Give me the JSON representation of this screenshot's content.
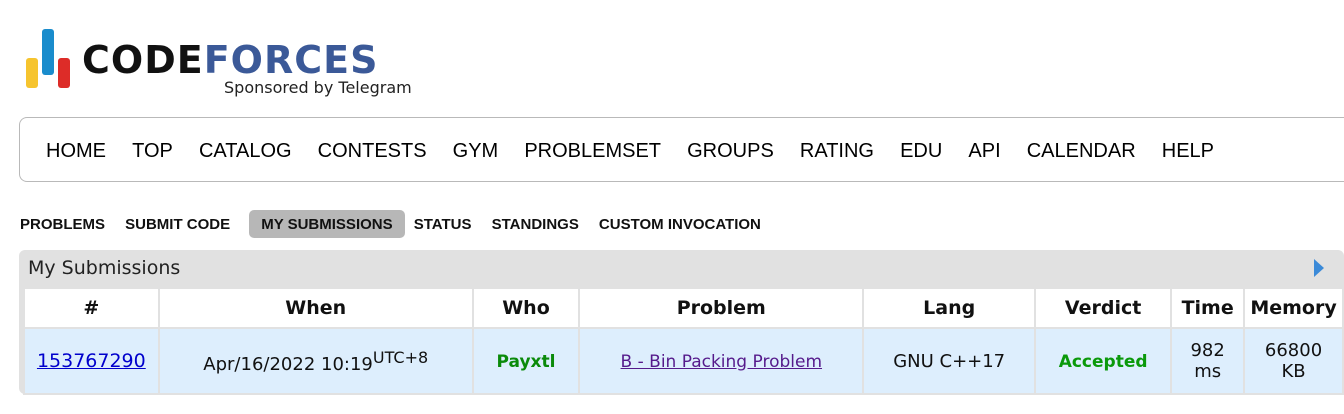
{
  "logo": {
    "word_part1": "CODE",
    "word_part2": "FORCES",
    "sponsor": "Sponsored by Telegram",
    "colors": {
      "yellow": "#f6c42e",
      "blue": "#1a8ccc",
      "red": "#dd2c28",
      "forces": "#3b5998"
    }
  },
  "main_menu": [
    "HOME",
    "TOP",
    "CATALOG",
    "CONTESTS",
    "GYM",
    "PROBLEMSET",
    "GROUPS",
    "RATING",
    "EDU",
    "API",
    "CALENDAR",
    "HELP"
  ],
  "second_menu": {
    "items": [
      "PROBLEMS",
      "SUBMIT CODE",
      "MY SUBMISSIONS",
      "STATUS",
      "STANDINGS",
      "CUSTOM INVOCATION"
    ],
    "active": "MY SUBMISSIONS"
  },
  "submissions": {
    "title": "My Submissions",
    "columns": [
      "#",
      "When",
      "Who",
      "Problem",
      "Lang",
      "Verdict",
      "Time",
      "Memory"
    ],
    "rows": [
      {
        "id": "153767290",
        "when": "Apr/16/2022 10:19",
        "timezone": "UTC+8",
        "who": "Payxtl",
        "problem": "B - Bin Packing Problem",
        "lang": "GNU C++17",
        "verdict": "Accepted",
        "time_value": "982",
        "time_unit": "ms",
        "memory_value": "66800",
        "memory_unit": "KB"
      }
    ],
    "colors": {
      "row_bg": "#ddeefd",
      "accepted": "#0a990a",
      "who": "#0a8a0a"
    }
  }
}
